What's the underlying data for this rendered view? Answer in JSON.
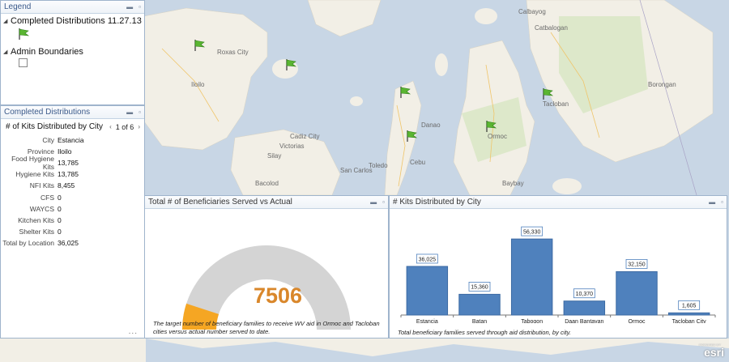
{
  "legend": {
    "title": "Legend",
    "layer1": "Completed Distributions 11.27.13",
    "layer2": "Admin Boundaries"
  },
  "details": {
    "title": "Completed Distributions",
    "subtitle": "# of Kits Distributed by City",
    "pager": "1 of 6",
    "fields": [
      {
        "label": "City",
        "value": "Estancia"
      },
      {
        "label": "Province",
        "value": "Iloilo"
      },
      {
        "label": "Food Hygiene Kits",
        "value": "13,785"
      },
      {
        "label": "Hygiene Kits",
        "value": "13,785"
      },
      {
        "label": "NFI Kits",
        "value": "8,455"
      },
      {
        "label": "CFS",
        "value": "0"
      },
      {
        "label": "WAYCS",
        "value": "0"
      },
      {
        "label": "Kitchen Kits",
        "value": "0"
      },
      {
        "label": "Shelter Kits",
        "value": "0"
      },
      {
        "label": "Total by Location",
        "value": "36,025"
      }
    ],
    "more": "..."
  },
  "gauge": {
    "title": "Total # of Beneficiaries Served vs Actual",
    "value": "7506",
    "fraction": 0.1,
    "caption_line1": "The target number of beneficiary families to receive WV aid in Ormoc and Tacloban",
    "caption_line2": "cities versus actual number served to date."
  },
  "bars": {
    "title": "# Kits Distributed by City",
    "caption": "Total beneficiary families served through aid distribution, by city.",
    "chart_data": {
      "type": "bar",
      "categories": [
        "Estancia",
        "Batan",
        "Tabogon",
        "Daan Bantayan",
        "Ormoc",
        "Tacloban City"
      ],
      "values": [
        36025,
        15360,
        56330,
        10370,
        32150,
        1605
      ],
      "labels": [
        "36,025",
        "15,360",
        "56,330",
        "10,370",
        "32,150",
        "1,605"
      ],
      "ylim": [
        0,
        60000
      ],
      "color": "#4f81bd"
    }
  },
  "map": {
    "places": [
      "Roxas City",
      "Iloilo",
      "Bacolod",
      "Silay",
      "Victorias",
      "Cadiz City",
      "Cebu",
      "Ormoc",
      "Tacloban",
      "Baybay",
      "Catbalogan",
      "Calbayog",
      "Borongan",
      "San Carlos",
      "Toledo",
      "Danao"
    ],
    "water_color": "#c8d6e5",
    "land_color": "#f2efe6"
  },
  "esri": {
    "text": "esri",
    "powered": "POWERED BY"
  },
  "window_controls": {
    "minimize": "▬",
    "maximize": "▫"
  }
}
